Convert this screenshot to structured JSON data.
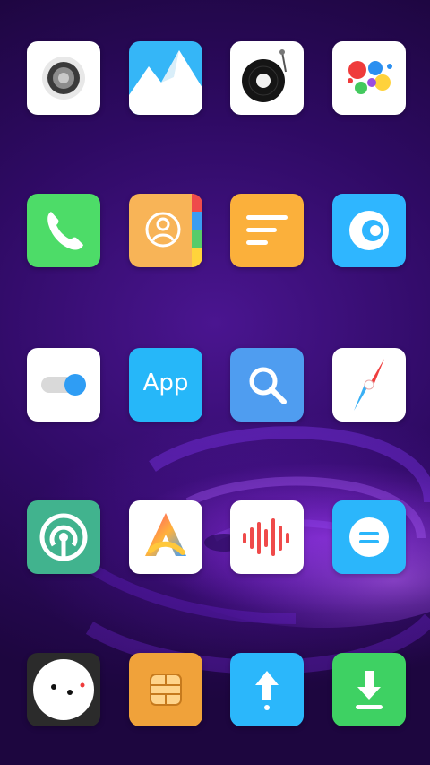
{
  "home_screen": {
    "apps": [
      {
        "icon": "speaker-icon",
        "bg": "#ffffff"
      },
      {
        "icon": "gallery-mountains-icon",
        "bg": "#35b6f7"
      },
      {
        "icon": "vinyl-record-icon",
        "bg": "#ffffff"
      },
      {
        "icon": "paint-splash-icon",
        "bg": "#ffffff"
      },
      {
        "icon": "phone-icon",
        "bg": "#4ddc68"
      },
      {
        "icon": "contacts-icon",
        "bg": "#f8b457"
      },
      {
        "icon": "notes-icon",
        "bg": "#fbb03b"
      },
      {
        "icon": "browser-swirl-icon",
        "bg": "#2fb6ff"
      },
      {
        "icon": "toggle-settings-icon",
        "bg": "#ffffff"
      },
      {
        "icon": "app-store-icon",
        "bg": "#26b7f9",
        "label": "App"
      },
      {
        "icon": "search-icon",
        "bg": "#4f9df0"
      },
      {
        "icon": "compass-icon",
        "bg": "#ffffff"
      },
      {
        "icon": "hotspot-icon",
        "bg": "#41b38e"
      },
      {
        "icon": "gradient-a-icon",
        "bg": "#ffffff"
      },
      {
        "icon": "voice-recorder-icon",
        "bg": "#ffffff"
      },
      {
        "icon": "menu-equals-icon",
        "bg": "#2bb6fb"
      },
      {
        "icon": "face-icon",
        "bg": "#2b2b2b"
      },
      {
        "icon": "sim-card-icon",
        "bg": "#f0a23a"
      },
      {
        "icon": "upload-arrow-icon",
        "bg": "#2bb7fb"
      },
      {
        "icon": "download-icon",
        "bg": "#3ed163"
      }
    ]
  }
}
